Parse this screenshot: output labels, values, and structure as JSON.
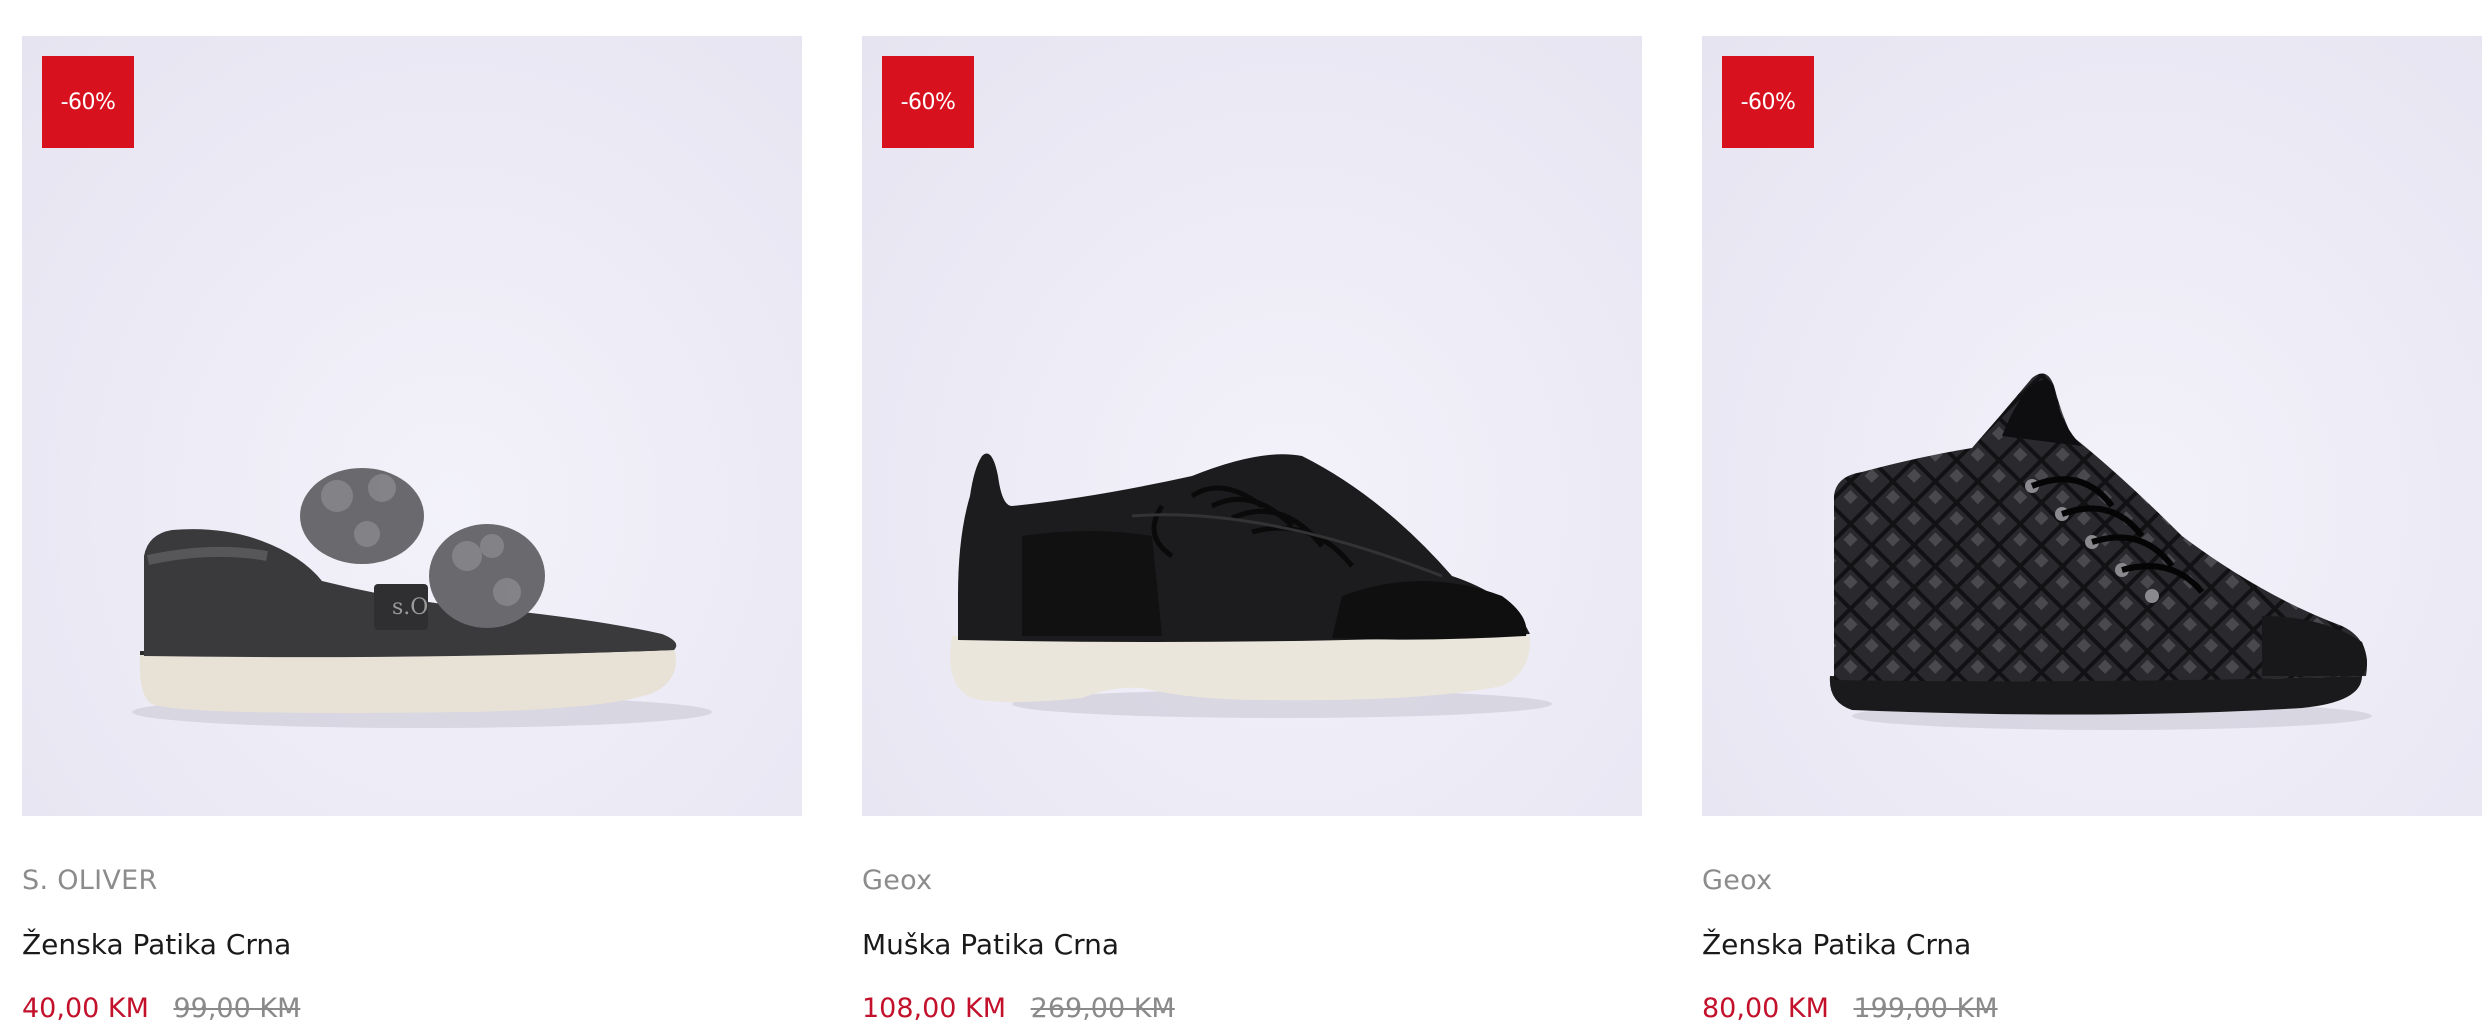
{
  "colors": {
    "badge": "#d8111f",
    "price_sale": "#c3102b",
    "price_old": "#8a8a8a",
    "brand": "#8c8c8c",
    "name": "#1a1a1a",
    "image_background": "#ecebf5"
  },
  "products": [
    {
      "badge": "-60%",
      "image_icon": "fur-strap-sneaker-image",
      "brand": "S. OLIVER",
      "name": "Ženska Patika Crna",
      "price": "40,00 KM",
      "old_price": "99,00 KM"
    },
    {
      "badge": "-60%",
      "image_icon": "lace-up-sneaker-image",
      "brand": "Geox",
      "name": "Muška Patika Crna",
      "price": "108,00 KM",
      "old_price": "269,00 KM"
    },
    {
      "badge": "-60%",
      "image_icon": "quilted-high-top-sneaker-image",
      "brand": "Geox",
      "name": "Ženska Patika Crna",
      "price": "80,00 KM",
      "old_price": "199,00 KM"
    }
  ]
}
